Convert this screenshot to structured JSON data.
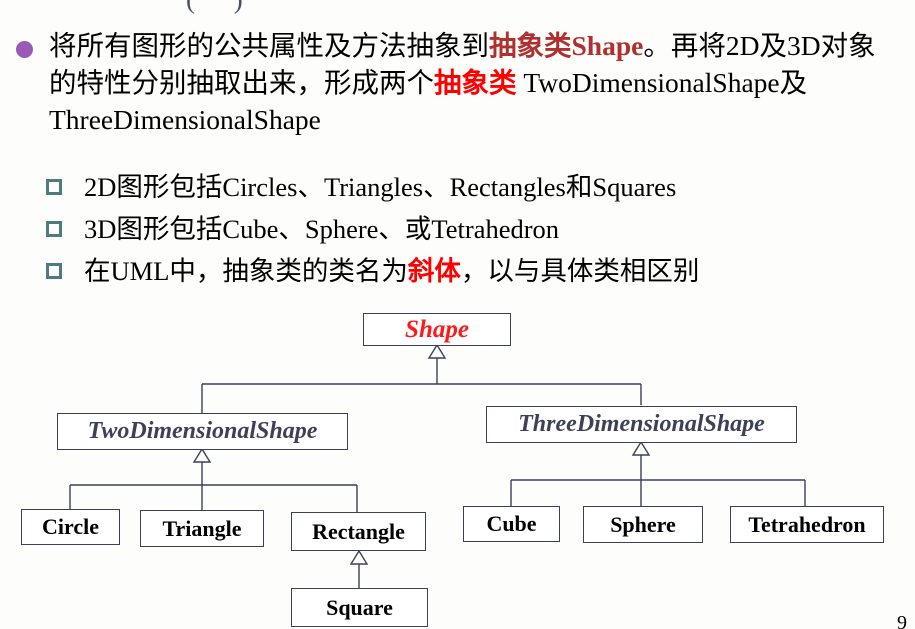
{
  "slide": {
    "top_fragment": "( )",
    "page_number": "9",
    "background_color": "#fdfdfb"
  },
  "colors": {
    "bullet_dot": "#9b59b6",
    "sub_marker": "#4d7b80",
    "red_dark": "#b03030",
    "red_bright": "#ff0000",
    "diagram_line": "#3c4059",
    "abstract_text": "#3c4059",
    "leaf_text": "#000000"
  },
  "main_bullet": {
    "segments": [
      {
        "text": "将所有图形的公共属性及方法抽象到",
        "style": "normal"
      },
      {
        "text": "抽象类Shape",
        "style": "red-dark"
      },
      {
        "text": "。再将2D及3D对象的特性分别抽取出来，形成两个",
        "style": "normal"
      },
      {
        "text": "抽象类",
        "style": "red-bright"
      },
      {
        "text": " TwoDimensionalShape及ThreeDimensionalShape",
        "style": "normal"
      }
    ],
    "plain_text": "将所有图形的公共属性及方法抽象到抽象类Shape。再将2D及3D对象的特性分别抽取出来，形成两个抽象类 TwoDimensionalShape及ThreeDimensionalShape"
  },
  "sub_bullets": [
    {
      "segments": [
        {
          "text": "2D图形包括Circles、Triangles、Rectangles和Squares",
          "style": "normal"
        }
      ],
      "plain_text": "2D图形包括Circles、Triangles、Rectangles和Squares"
    },
    {
      "segments": [
        {
          "text": "3D图形包括Cube、Sphere、或Tetrahedron",
          "style": "normal"
        }
      ],
      "plain_text": "3D图形包括Cube、Sphere、或Tetrahedron"
    },
    {
      "segments": [
        {
          "text": "在UML中，抽象类的类名为",
          "style": "normal"
        },
        {
          "text": "斜体",
          "style": "red-bright"
        },
        {
          "text": "，以与具体类相区别",
          "style": "normal"
        }
      ],
      "plain_text": "在UML中，抽象类的类名为斜体，以与具体类相区别"
    }
  ],
  "diagram": {
    "type": "uml-class-hierarchy",
    "nodes": {
      "root": {
        "label": "Shape",
        "kind": "abstract"
      },
      "two_d": {
        "label": "TwoDimensionalShape",
        "kind": "abstract"
      },
      "three_d": {
        "label": "ThreeDimensionalShape",
        "kind": "abstract"
      },
      "circle": {
        "label": "Circle",
        "kind": "concrete"
      },
      "triangle": {
        "label": "Triangle",
        "kind": "concrete"
      },
      "rectangle": {
        "label": "Rectangle",
        "kind": "concrete"
      },
      "square": {
        "label": "Square",
        "kind": "concrete"
      },
      "cube": {
        "label": "Cube",
        "kind": "concrete"
      },
      "sphere": {
        "label": "Sphere",
        "kind": "concrete"
      },
      "tetrahedron": {
        "label": "Tetrahedron",
        "kind": "concrete"
      }
    },
    "edges": [
      {
        "from": "two_d",
        "to": "root",
        "relation": "generalization"
      },
      {
        "from": "three_d",
        "to": "root",
        "relation": "generalization"
      },
      {
        "from": "circle",
        "to": "two_d",
        "relation": "generalization"
      },
      {
        "from": "triangle",
        "to": "two_d",
        "relation": "generalization"
      },
      {
        "from": "rectangle",
        "to": "two_d",
        "relation": "generalization"
      },
      {
        "from": "square",
        "to": "rectangle",
        "relation": "generalization"
      },
      {
        "from": "cube",
        "to": "three_d",
        "relation": "generalization"
      },
      {
        "from": "sphere",
        "to": "three_d",
        "relation": "generalization"
      },
      {
        "from": "tetrahedron",
        "to": "three_d",
        "relation": "generalization"
      }
    ]
  }
}
